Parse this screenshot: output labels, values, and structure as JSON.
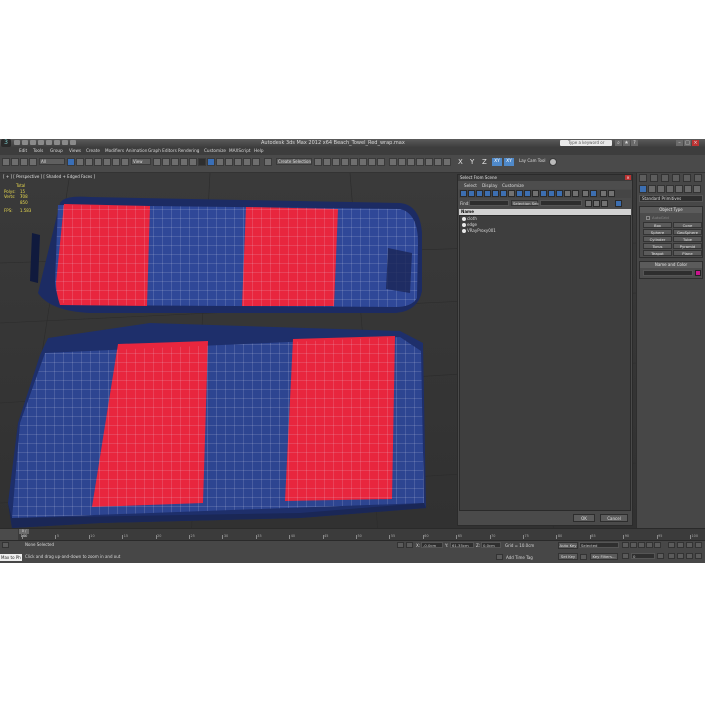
{
  "app": {
    "title": "Autodesk 3ds Max  2012 x64      Beach_Towel_Red_wrap.max",
    "logo": "3"
  },
  "search": {
    "placeholder": "Type a keyword or phrase"
  },
  "menu": [
    "Edit",
    "Tools",
    "Group",
    "Views",
    "Create",
    "Modifiers",
    "Animation",
    "Graph Editors",
    "Rendering",
    "Customize",
    "MAXScript",
    "Help"
  ],
  "toolbar": {
    "selection_filter": "All",
    "coord_system": "View",
    "named_selection": "Create Selection",
    "axes": [
      "X",
      "Y",
      "Z"
    ],
    "axis_buttons": [
      "XY",
      "XY"
    ],
    "caddy_label": "Lay Cam Tool"
  },
  "viewport": {
    "label": "[ + ] [ Perspective ] [ Shaded + Edged Faces ]",
    "stats": {
      "total_label": "Total",
      "polys_label": "Polys:",
      "polys_value": "15 708",
      "verts_label": "Verts:",
      "verts_value": "7 850",
      "fps_label": "FPS:",
      "fps_value": "1.583"
    }
  },
  "scene_dialog": {
    "title": "Select From Scene",
    "menu": [
      "Select",
      "Display",
      "Customize"
    ],
    "find_label": "Find:",
    "selection_set_label": "Selection Set:",
    "column_header": "Name",
    "items": [
      "cloth",
      "edge",
      "VRayProxy001"
    ],
    "ok_label": "OK",
    "cancel_label": "Cancel"
  },
  "command_panel": {
    "category_dropdown": "Standard Primitives",
    "object_type_title": "Object Type",
    "autogrid_label": "AutoGrid",
    "primitives": [
      "Box",
      "Cone",
      "Sphere",
      "GeoSphere",
      "Cylinder",
      "Tube",
      "Torus",
      "Pyramid",
      "Teapot",
      "Plane"
    ],
    "name_color_title": "Name and Color",
    "color": "#c8148c"
  },
  "timeline": {
    "frame_display": "0 / 100",
    "ticks": [
      "0",
      "5",
      "10",
      "15",
      "20",
      "25",
      "30",
      "35",
      "40",
      "45",
      "50",
      "55",
      "60",
      "65",
      "70",
      "75",
      "80",
      "85",
      "90",
      "95",
      "100"
    ]
  },
  "status": {
    "selection": "None Selected",
    "prompt": "Click and drag up-and-down to zoom in and out",
    "maxscript": "Max to Ph",
    "x_label": "X:",
    "x_value": "-0.0cm",
    "y_label": "Y:",
    "y_value": "61.35cm",
    "z_label": "Z:",
    "z_value": "0.0cm",
    "grid": "Grid = 10.0cm",
    "auto_key": "Auto Key",
    "set_key": "Set Key",
    "key_mode": "Selected",
    "key_filters": "Key Filters...",
    "add_time_tag": "Add Time Tag",
    "frame": "0"
  }
}
